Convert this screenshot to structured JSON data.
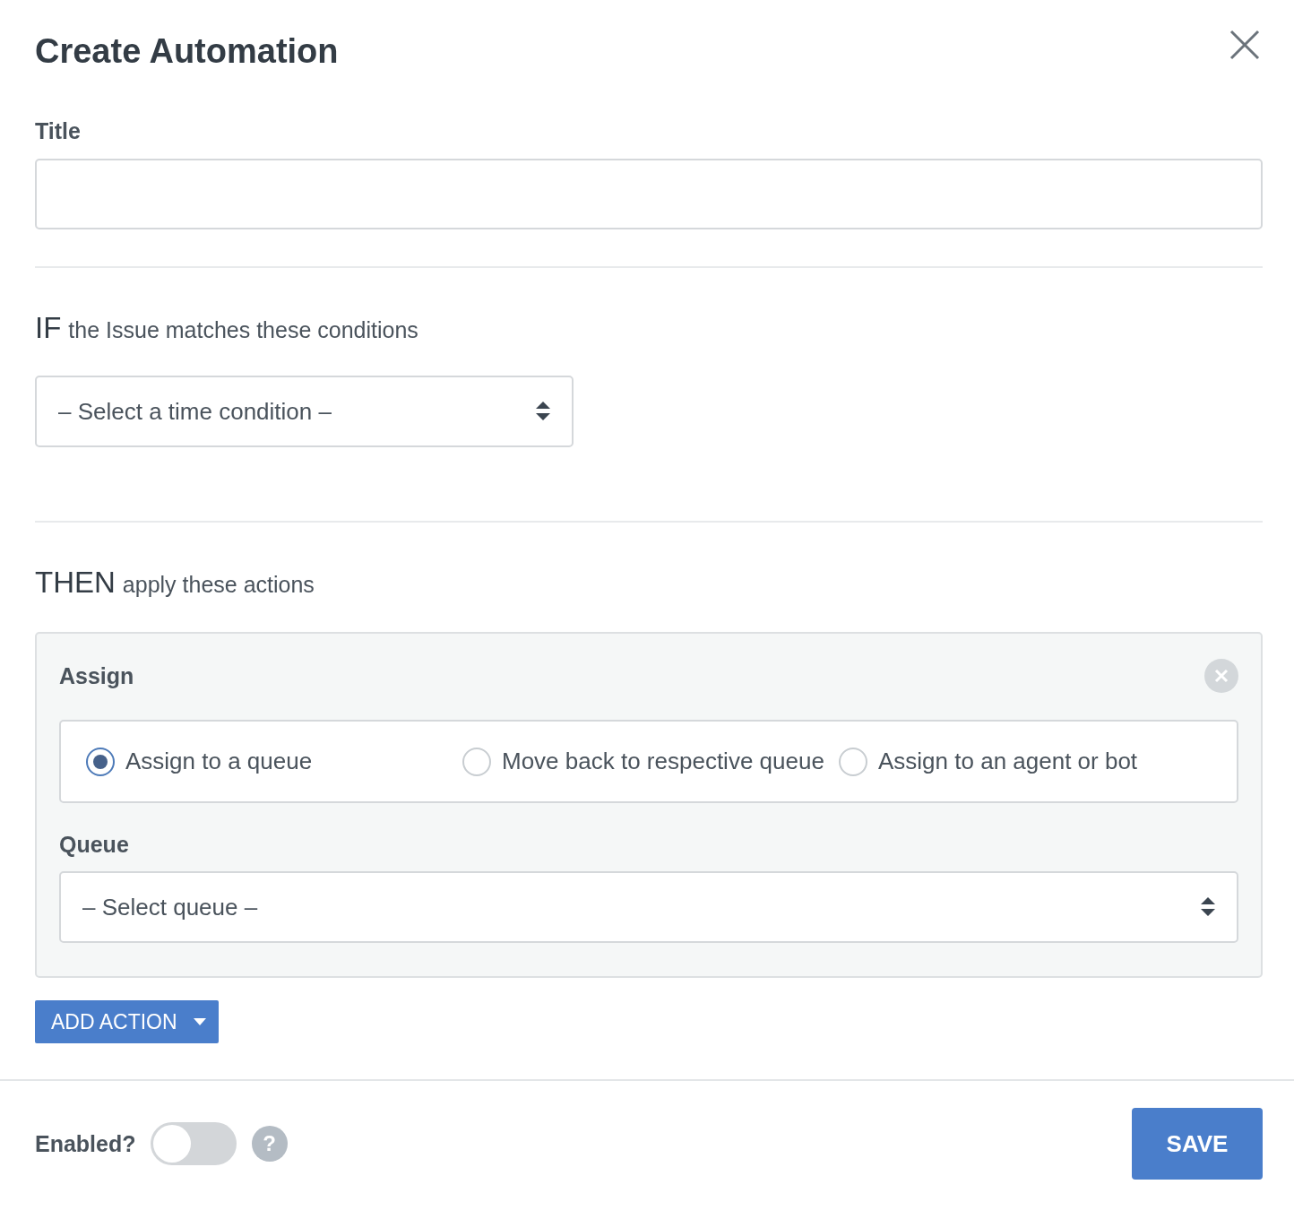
{
  "dialog": {
    "title": "Create Automation"
  },
  "title_field": {
    "label": "Title"
  },
  "conditions": {
    "keyword": "IF",
    "text": "the Issue matches these conditions",
    "select": {
      "placeholder": "– Select a time condition –"
    }
  },
  "actions_section": {
    "keyword": "THEN",
    "text": "apply these actions"
  },
  "actions": [
    {
      "title": "Assign",
      "options": [
        {
          "label": "Assign to a queue",
          "selected": true
        },
        {
          "label": "Move back to respective queue",
          "selected": false
        },
        {
          "label": "Assign to an agent or bot",
          "selected": false
        }
      ],
      "field_label": "Queue",
      "select": {
        "placeholder": "– Select queue –"
      }
    }
  ],
  "add_action_button": "ADD ACTION",
  "footer": {
    "enabled_label": "Enabled?",
    "enabled": false,
    "help": "?",
    "save_button": "SAVE"
  }
}
